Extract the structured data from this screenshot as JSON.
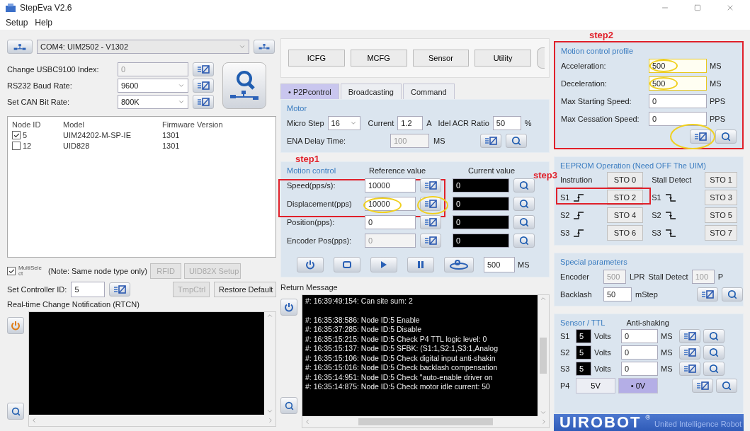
{
  "window": {
    "title": "StepEva V2.6"
  },
  "menu": [
    "Setup",
    "Help"
  ],
  "connection": {
    "port": "COM4: UIM2502 - V1302"
  },
  "settings": [
    {
      "label": "Change USBC9100 Index:",
      "value": "0",
      "kind": "input",
      "disabled": true
    },
    {
      "label": "RS232 Baud Rate:",
      "value": "9600",
      "kind": "select",
      "disabled": false
    },
    {
      "label": "Set CAN Bit Rate:",
      "value": "800K",
      "kind": "select",
      "disabled": false
    }
  ],
  "node_table": {
    "columns": [
      "Node ID",
      "Model",
      "Firmware Version"
    ],
    "rows": [
      {
        "id": "5",
        "checked": true,
        "model": "UIM24202-M-SP-IE",
        "firmware": "1301"
      },
      {
        "id": "12",
        "checked": false,
        "model": "UID828",
        "firmware": "1301"
      }
    ]
  },
  "multiselect": {
    "lines": [
      "MultiSele",
      "ct"
    ],
    "checked": true
  },
  "note": "(Note: Same node type only)",
  "buttons_row1": [
    {
      "label": "RFID",
      "disabled": true
    },
    {
      "label": "UID82X Setup",
      "disabled": true
    }
  ],
  "controller_id": {
    "label": "Set Controller ID:",
    "value": "5"
  },
  "buttons_row2": [
    {
      "label": "TmpCtrl",
      "disabled": true
    },
    {
      "label": "Restore Default",
      "disabled": false
    }
  ],
  "rtcn": {
    "title": "Real-time Change Notification (RTCN)"
  },
  "function_buttons": [
    "ICFG",
    "MCFG",
    "Sensor",
    "Utility"
  ],
  "tabs": [
    {
      "label": "• P2Pcontrol",
      "selected": true
    },
    {
      "label": "Broadcasting",
      "selected": false
    },
    {
      "label": "Command",
      "selected": false
    }
  ],
  "motor": {
    "title": "Motor",
    "micro_step_label": "Micro Step",
    "micro_step": "16",
    "current_label": "Current",
    "current": "1.2",
    "current_unit": "A",
    "idle_label": "Idel ACR Ratio",
    "idle": "50",
    "idle_unit": "%",
    "ena_label": "ENA Delay Time:",
    "ena": "100",
    "ena_unit": "MS"
  },
  "motion_control": {
    "title": "Motion control",
    "annotation": "step1",
    "headers": [
      "Reference value",
      "Current value"
    ],
    "rows": [
      {
        "label": "Speed(pps/s):",
        "reference": "10000",
        "current": "0",
        "disabled": false,
        "highlighted": false
      },
      {
        "label": "Displacement(pps)",
        "reference": "10000",
        "current": "0",
        "disabled": false,
        "highlighted": true
      },
      {
        "label": "Position(pps):",
        "reference": "0",
        "current": "0",
        "disabled": false,
        "highlighted": false
      },
      {
        "label": "Encoder Pos(pps):",
        "reference": "0",
        "current": "0",
        "disabled": true,
        "highlighted": false
      }
    ]
  },
  "playback": {
    "interval": "500",
    "unit": "MS"
  },
  "return_message": {
    "title": "Return Message",
    "lines": [
      "#: 16:39:49:154: Can site sum: 2",
      "#: 16:35:38:586: Node ID:5 Enable",
      "#: 16:35:37:285: Node ID:5 Disable",
      "#: 16:35:15:215: Node ID:5 Check P4 TTL logic level: 0",
      "#: 16:35:15:137: Node ID:5 SFBK: (S1:1,S2:1,S3:1,Analog",
      "#: 16:35:15:106: Node ID:5 Check digital input anti-shakin",
      "#: 16:35:15:016: Node ID:5 Check backlash compensation",
      "#: 16:35:14:951: Node ID:5 Check \"auto-enable driver on",
      "#: 16:35:14:875: Node ID:5 Check motor idle current: 50"
    ]
  },
  "motion_profile": {
    "annotation": "step2",
    "title": "Motion control profile",
    "highlight_write": true,
    "rows": [
      {
        "label": "Acceleration:",
        "value": "500",
        "unit": "MS",
        "highlighted": true
      },
      {
        "label": "Deceleration:",
        "value": "500",
        "unit": "MS",
        "highlighted": true
      },
      {
        "label": "Max Starting Speed:",
        "value": "0",
        "unit": "PPS",
        "highlighted": false
      },
      {
        "label": "Max Cessation Speed:",
        "value": "0",
        "unit": "PPS",
        "highlighted": false
      }
    ]
  },
  "eeprom": {
    "title": "EEPROM Operation (Need OFF The UIM)",
    "annotation": "step3",
    "rows": [
      {
        "kind": "header",
        "left_label": "Instrution",
        "left_button": "STO 0",
        "right_label": "Stall Detect",
        "right_button": "STO 1"
      },
      {
        "kind": "signal",
        "left_label": "S1",
        "left_button": "STO 2",
        "right_label": "S1",
        "right_button": "STO 3"
      },
      {
        "kind": "signal",
        "left_label": "S2",
        "left_button": "STO 4",
        "right_label": "S2",
        "right_button": "STO 5"
      },
      {
        "kind": "signal",
        "left_label": "S3",
        "left_button": "STO 6",
        "right_label": "S3",
        "right_button": "STO 7"
      }
    ]
  },
  "special": {
    "title": "Special parameters",
    "encoder_label": "Encoder",
    "encoder": "500",
    "encoder_unit": "LPR",
    "stall_label": "Stall Detect",
    "stall": "100",
    "stall_unit": "P",
    "backlash_label": "Backlash",
    "backlash": "50",
    "backlash_unit": "mStep"
  },
  "sensor": {
    "title": "Sensor / TTL",
    "anti_label": "Anti-shaking",
    "rows": [
      {
        "label": "S1",
        "volts": "5",
        "volts_unit": "Volts",
        "anti": "0",
        "anti_unit": "MS"
      },
      {
        "label": "S2",
        "volts": "5",
        "volts_unit": "Volts",
        "anti": "0",
        "anti_unit": "MS"
      },
      {
        "label": "S3",
        "volts": "5",
        "volts_unit": "Volts",
        "anti": "0",
        "anti_unit": "MS"
      }
    ],
    "p4": {
      "label": "P4",
      "options": [
        {
          "label": "5V",
          "selected": false
        },
        {
          "label": "• 0V",
          "selected": true
        }
      ]
    }
  },
  "logo": {
    "name": "UIROBOT",
    "mark": "®",
    "tagline": "United Intelligence Robot"
  }
}
